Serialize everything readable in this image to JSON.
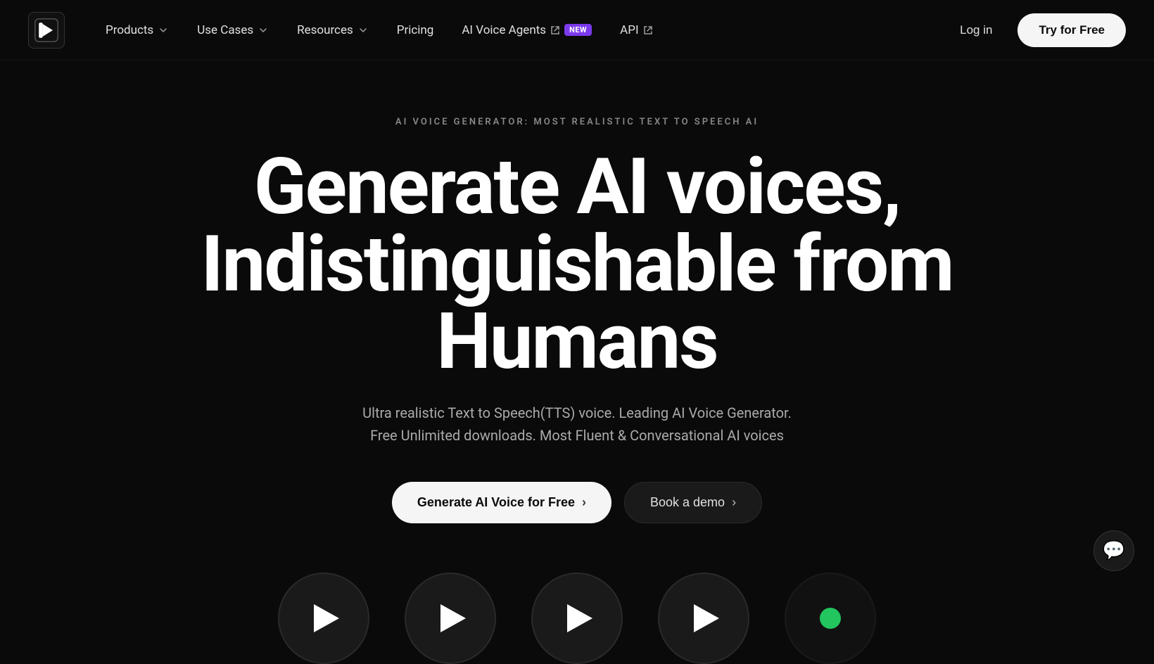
{
  "brand": {
    "logo_alt": "PlayHT Logo"
  },
  "navbar": {
    "items": [
      {
        "label": "Products",
        "has_chevron": true,
        "has_external": false,
        "badge": null
      },
      {
        "label": "Use Cases",
        "has_chevron": true,
        "has_external": false,
        "badge": null
      },
      {
        "label": "Resources",
        "has_chevron": true,
        "has_external": false,
        "badge": null
      },
      {
        "label": "Pricing",
        "has_chevron": false,
        "has_external": false,
        "badge": null
      },
      {
        "label": "AI Voice Agents",
        "has_chevron": false,
        "has_external": true,
        "badge": "NEW"
      },
      {
        "label": "API",
        "has_chevron": false,
        "has_external": true,
        "badge": null
      }
    ],
    "login_label": "Log in",
    "try_free_label": "Try for Free"
  },
  "hero": {
    "eyebrow": "AI VOICE GENERATOR: MOST REALISTIC TEXT TO SPEECH AI",
    "title_line1": "Generate AI voices,",
    "title_line2": "Indistinguishable from",
    "title_line3": "Humans",
    "subtitle": "Ultra realistic Text to Speech(TTS) voice. Leading AI Voice Generator.\nFree Unlimited downloads. Most Fluent & Conversational AI voices",
    "cta_primary": "Generate AI Voice for Free",
    "cta_secondary": "Book a demo"
  },
  "audio_players": [
    {
      "id": 1,
      "type": "play"
    },
    {
      "id": 2,
      "type": "play"
    },
    {
      "id": 3,
      "type": "play"
    },
    {
      "id": 4,
      "type": "play"
    },
    {
      "id": 5,
      "type": "dot"
    }
  ],
  "colors": {
    "background": "#0a0a0a",
    "text_primary": "#ffffff",
    "text_secondary": "#aaaaaa",
    "accent_purple": "#7c3aed",
    "accent_green": "#22c55e",
    "btn_light_bg": "#f5f5f5",
    "btn_dark_bg": "#1a1a1a"
  }
}
